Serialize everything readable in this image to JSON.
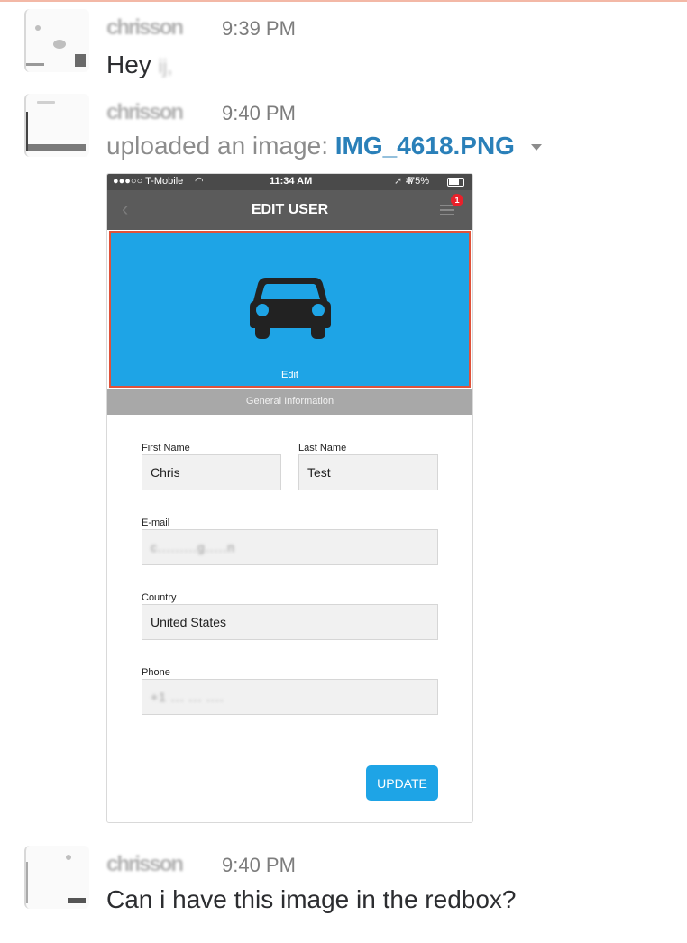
{
  "messages": [
    {
      "author": "chrisson",
      "time": "9:39 PM",
      "text": "Hey",
      "redacted_name": "ij,"
    },
    {
      "author": "chrisson",
      "time": "9:40 PM",
      "upload_prefix": "uploaded an image:",
      "file_name": "IMG_4618.PNG"
    },
    {
      "author": "chrisson",
      "time": "9:40 PM",
      "text": "Can i have this image in the redbox?"
    }
  ],
  "phone": {
    "status": {
      "carrier": "●●●○○ T-Mobile",
      "time": "11:34 AM",
      "battery": "75%"
    },
    "nav": {
      "back_icon": "chevron-left-icon",
      "title": "EDIT USER",
      "menu_icon": "hamburger-menu-icon",
      "notification_count": "1"
    },
    "hero": {
      "icon": "car-icon",
      "edit_label": "Edit"
    },
    "section_title": "General Information",
    "fields": {
      "first_name": {
        "label": "First Name",
        "value": "Chris"
      },
      "last_name": {
        "label": "Last Name",
        "value": "Test"
      },
      "email": {
        "label": "E-mail",
        "value": "c.........g.....n"
      },
      "country": {
        "label": "Country",
        "value": "United States"
      },
      "phone": {
        "label": "Phone",
        "value": "+1  ... ... ...."
      }
    },
    "update_label": "UPDATE"
  },
  "colors": {
    "accent": "#1ea4e6",
    "highlight_box": "#e0523a",
    "link": "#2a80b9",
    "nav_bg": "#5b5b5b"
  }
}
